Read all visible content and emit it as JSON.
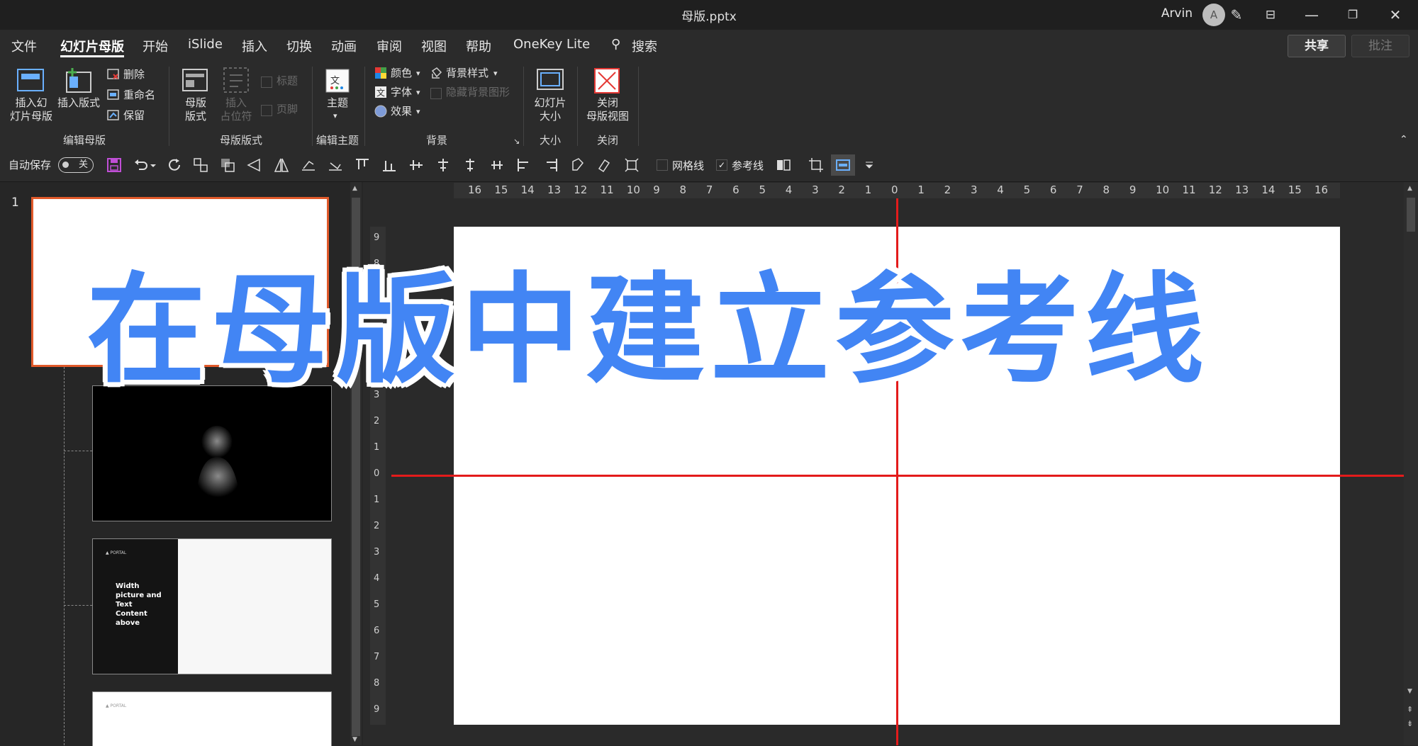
{
  "window": {
    "title": "母版.pptx",
    "user": "Arvin",
    "avatar_letter": "A"
  },
  "tabs": [
    "文件",
    "幻灯片母版",
    "开始",
    "iSlide",
    "插入",
    "切换",
    "动画",
    "审阅",
    "视图",
    "帮助",
    "OneKey Lite"
  ],
  "active_tab": "幻灯片母版",
  "search_label": "搜索",
  "share_label": "共享",
  "comment_label": "批注",
  "ribbon": {
    "insert_master": "插入幻\n灯片母版",
    "insert_layout": "插入版式",
    "delete": "删除",
    "rename": "重命名",
    "preserve": "保留",
    "group_edit_master": "编辑母版",
    "master_layout": "母版\n版式",
    "insert_placeholder": "插入\n占位符",
    "title_cb": "标题",
    "footer_cb": "页脚",
    "group_master_layout": "母版版式",
    "theme": "主题",
    "group_edit_theme": "编辑主题",
    "colors": "颜色",
    "fonts": "字体",
    "effects": "效果",
    "bg_styles": "背景样式",
    "hide_bg": "隐藏背景图形",
    "group_background": "背景",
    "slide_size": "幻灯片\n大小",
    "group_size": "大小",
    "close_master": "关闭\n母版视图",
    "group_close": "关闭"
  },
  "qat": {
    "autosave": "自动保存",
    "autosave_state": "关",
    "gridlines": "网格线",
    "guides": "参考线",
    "gridlines_checked": false,
    "guides_checked": true
  },
  "slide_number": "1",
  "thumbs": {
    "layout2_text": "Width picture and Text Content above",
    "brand": "PORTAL"
  },
  "ruler_h": [
    "16",
    "15",
    "14",
    "13",
    "12",
    "11",
    "10",
    "9",
    "8",
    "7",
    "6",
    "5",
    "4",
    "3",
    "2",
    "1",
    "0",
    "1",
    "2",
    "3",
    "4",
    "5",
    "6",
    "7",
    "8",
    "9",
    "10",
    "11",
    "12",
    "13",
    "14",
    "15",
    "16"
  ],
  "ruler_v": [
    "9",
    "8",
    "7",
    "6",
    "5",
    "4",
    "3",
    "2",
    "1",
    "0",
    "1",
    "2",
    "3",
    "4",
    "5",
    "6",
    "7",
    "8",
    "9"
  ],
  "overlay_title": "在母版中建立参考线",
  "colors": {
    "guide": "#e31b1b",
    "overlay": "#4285f4",
    "selection": "#e0592a"
  }
}
